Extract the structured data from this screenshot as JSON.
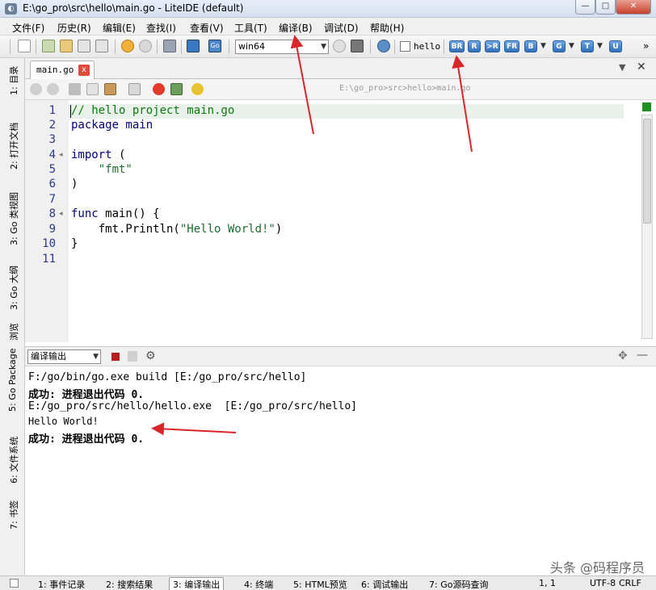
{
  "window": {
    "title": "E:\\go_pro\\src\\hello\\main.go - LiteIDE (default)",
    "min_label": "—",
    "max_label": "□",
    "close_label": "✕"
  },
  "menu": [
    "文件(F)",
    "历史(R)",
    "编辑(E)",
    "查找(I)",
    "查看(V)",
    "工具(T)",
    "编译(B)",
    "调试(D)",
    "帮助(H)"
  ],
  "toolbar": {
    "env_combo": "win64",
    "target_checkbox_label": "hello",
    "build_buttons": [
      "BR",
      "R",
      ">R",
      "FR",
      "B",
      "G",
      "T",
      "U"
    ],
    "overflow": "»"
  },
  "left_tabs": [
    "1: 目录",
    "2: 打开文档",
    "3: Go 类视图",
    "3: Go 大纲",
    "浏览",
    "5: Go Package",
    "6: 文件系统",
    "7: 书签"
  ],
  "editor": {
    "tab_label": "main.go",
    "tab_close": "x",
    "breadcrumb": "E:\\go_pro>src>hello>main.go",
    "line_numbers": [
      "1",
      "2",
      "3",
      "4",
      "5",
      "6",
      "7",
      "8",
      "9",
      "10",
      "11"
    ],
    "fold_markers": {
      "4": "◂",
      "8": "◂"
    },
    "lines": {
      "l1": "// hello project main.go",
      "l2": "package main",
      "l4a": "import",
      "l4b": " (",
      "l5": "    \"fmt\"",
      "l7": ")",
      "l8a": "func",
      "l8b": " main() {",
      "l9a": "    fmt.Println(",
      "l9b": "\"Hello World!\"",
      "l9c": ")",
      "l10": "}"
    }
  },
  "output": {
    "combo": "编译输出",
    "lines": [
      "F:/go/bin/go.exe build [E:/go_pro/src/hello]",
      "成功: 进程退出代码 0.",
      "E:/go_pro/src/hello/hello.exe  [E:/go_pro/src/hello]",
      "Hello World!",
      "成功: 进程退出代码 0."
    ]
  },
  "status_tabs": [
    "1: 事件记录",
    "2: 搜索结果",
    "3: 编译输出",
    "4: 终端",
    "5: HTML预览",
    "6: 调试输出",
    "7: Go源码查询"
  ],
  "status": {
    "position": "1,  1",
    "encoding": "UTF-8",
    "eol": "CRLF"
  },
  "watermark": "头条 @码程序员",
  "colors": {
    "comment": "#0b7a0b",
    "keyword": "#00007f",
    "string": "#1a6e2e",
    "accent_blue": "#2f6fba",
    "arrow_red": "#d9262a"
  }
}
